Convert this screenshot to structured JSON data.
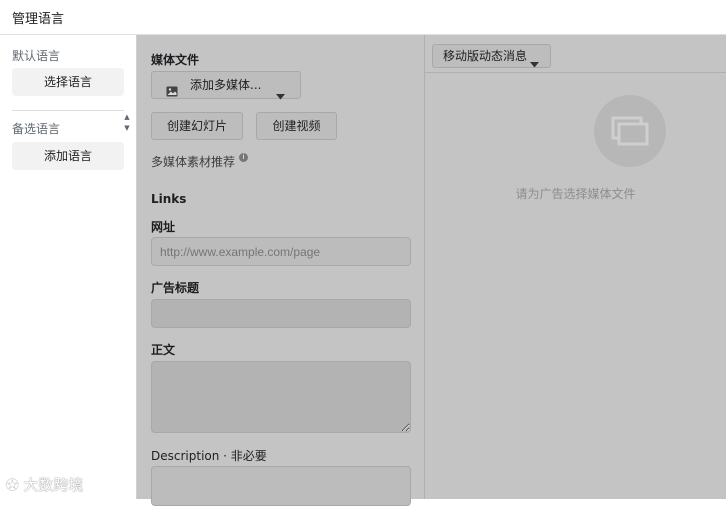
{
  "window": {
    "title": "管理语言"
  },
  "left_panel": {
    "default_language_label": "默认语言",
    "select_language_button": "选择语言",
    "alt_language_label": "备选语言",
    "add_language_button": "添加语言",
    "spinner_up": "▲",
    "spinner_down": "▼"
  },
  "media_section": {
    "title": "媒体文件",
    "add_media_button": "添加多媒体...",
    "create_slideshow_button": "创建幻灯片",
    "create_video_button": "创建视频",
    "recommendations_label": "多媒体素材推荐",
    "info_glyph": "i"
  },
  "links_section": {
    "title": "Links",
    "url_label": "网址",
    "url_placeholder": "http://www.example.com/page",
    "headline_label": "广告标题",
    "headline_value": "",
    "body_label": "正文",
    "body_value": "",
    "description_label": "Description · 非必要",
    "description_value": ""
  },
  "preview": {
    "placement_dropdown": "移动版动态消息",
    "empty_text": "请为广告选择媒体文件"
  },
  "watermark": {
    "text": "大数跨境"
  }
}
